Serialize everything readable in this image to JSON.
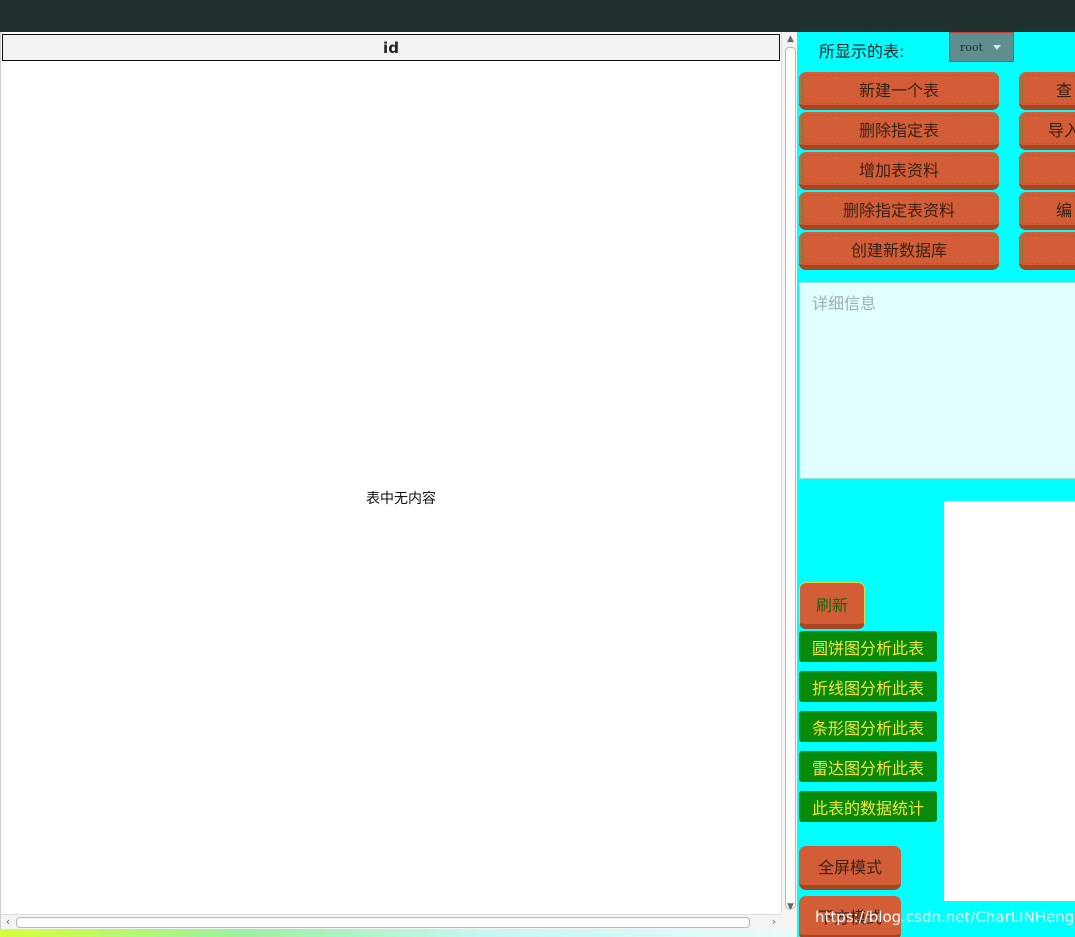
{
  "table": {
    "column_header": "id",
    "empty_message": "表中无内容"
  },
  "panel": {
    "shown_table_label": "所显示的表:",
    "table_select_value": "root",
    "left_buttons": [
      "新建一个表",
      "删除指定表",
      "增加表资料",
      "删除指定表资料",
      "创建新数据库"
    ],
    "right_buttons_partial": [
      "查",
      "导入",
      "",
      "编",
      ""
    ],
    "detail_placeholder": "详细信息",
    "refresh_label": "刷新",
    "analysis_buttons": [
      "圆饼图分析此表",
      "折线图分析此表",
      "条形图分析此表",
      "雷达图分析此表",
      "此表的数据统计"
    ],
    "fullscreen_label": "全屏模式",
    "next_button_partial": "下方模式"
  },
  "watermark": "https://blog.csdn.net/CharLINHeng",
  "colors": {
    "panel_bg": "#00ffff",
    "orange_button": "#d35d37",
    "green_button": "#0a8a0a",
    "titlebar": "#1f302e"
  }
}
